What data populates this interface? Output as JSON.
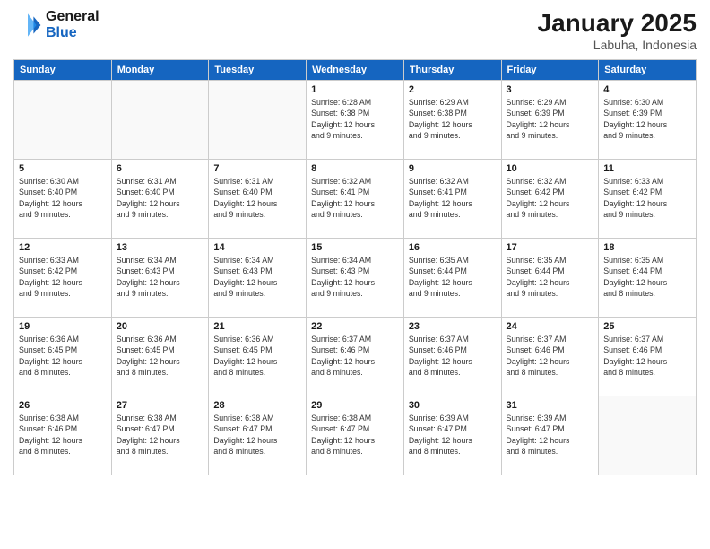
{
  "logo": {
    "line1": "General",
    "line2": "Blue"
  },
  "title": "January 2025",
  "location": "Labuha, Indonesia",
  "days_of_week": [
    "Sunday",
    "Monday",
    "Tuesday",
    "Wednesday",
    "Thursday",
    "Friday",
    "Saturday"
  ],
  "weeks": [
    [
      {
        "day": "",
        "info": ""
      },
      {
        "day": "",
        "info": ""
      },
      {
        "day": "",
        "info": ""
      },
      {
        "day": "1",
        "info": "Sunrise: 6:28 AM\nSunset: 6:38 PM\nDaylight: 12 hours\nand 9 minutes."
      },
      {
        "day": "2",
        "info": "Sunrise: 6:29 AM\nSunset: 6:38 PM\nDaylight: 12 hours\nand 9 minutes."
      },
      {
        "day": "3",
        "info": "Sunrise: 6:29 AM\nSunset: 6:39 PM\nDaylight: 12 hours\nand 9 minutes."
      },
      {
        "day": "4",
        "info": "Sunrise: 6:30 AM\nSunset: 6:39 PM\nDaylight: 12 hours\nand 9 minutes."
      }
    ],
    [
      {
        "day": "5",
        "info": "Sunrise: 6:30 AM\nSunset: 6:40 PM\nDaylight: 12 hours\nand 9 minutes."
      },
      {
        "day": "6",
        "info": "Sunrise: 6:31 AM\nSunset: 6:40 PM\nDaylight: 12 hours\nand 9 minutes."
      },
      {
        "day": "7",
        "info": "Sunrise: 6:31 AM\nSunset: 6:40 PM\nDaylight: 12 hours\nand 9 minutes."
      },
      {
        "day": "8",
        "info": "Sunrise: 6:32 AM\nSunset: 6:41 PM\nDaylight: 12 hours\nand 9 minutes."
      },
      {
        "day": "9",
        "info": "Sunrise: 6:32 AM\nSunset: 6:41 PM\nDaylight: 12 hours\nand 9 minutes."
      },
      {
        "day": "10",
        "info": "Sunrise: 6:32 AM\nSunset: 6:42 PM\nDaylight: 12 hours\nand 9 minutes."
      },
      {
        "day": "11",
        "info": "Sunrise: 6:33 AM\nSunset: 6:42 PM\nDaylight: 12 hours\nand 9 minutes."
      }
    ],
    [
      {
        "day": "12",
        "info": "Sunrise: 6:33 AM\nSunset: 6:42 PM\nDaylight: 12 hours\nand 9 minutes."
      },
      {
        "day": "13",
        "info": "Sunrise: 6:34 AM\nSunset: 6:43 PM\nDaylight: 12 hours\nand 9 minutes."
      },
      {
        "day": "14",
        "info": "Sunrise: 6:34 AM\nSunset: 6:43 PM\nDaylight: 12 hours\nand 9 minutes."
      },
      {
        "day": "15",
        "info": "Sunrise: 6:34 AM\nSunset: 6:43 PM\nDaylight: 12 hours\nand 9 minutes."
      },
      {
        "day": "16",
        "info": "Sunrise: 6:35 AM\nSunset: 6:44 PM\nDaylight: 12 hours\nand 9 minutes."
      },
      {
        "day": "17",
        "info": "Sunrise: 6:35 AM\nSunset: 6:44 PM\nDaylight: 12 hours\nand 9 minutes."
      },
      {
        "day": "18",
        "info": "Sunrise: 6:35 AM\nSunset: 6:44 PM\nDaylight: 12 hours\nand 8 minutes."
      }
    ],
    [
      {
        "day": "19",
        "info": "Sunrise: 6:36 AM\nSunset: 6:45 PM\nDaylight: 12 hours\nand 8 minutes."
      },
      {
        "day": "20",
        "info": "Sunrise: 6:36 AM\nSunset: 6:45 PM\nDaylight: 12 hours\nand 8 minutes."
      },
      {
        "day": "21",
        "info": "Sunrise: 6:36 AM\nSunset: 6:45 PM\nDaylight: 12 hours\nand 8 minutes."
      },
      {
        "day": "22",
        "info": "Sunrise: 6:37 AM\nSunset: 6:46 PM\nDaylight: 12 hours\nand 8 minutes."
      },
      {
        "day": "23",
        "info": "Sunrise: 6:37 AM\nSunset: 6:46 PM\nDaylight: 12 hours\nand 8 minutes."
      },
      {
        "day": "24",
        "info": "Sunrise: 6:37 AM\nSunset: 6:46 PM\nDaylight: 12 hours\nand 8 minutes."
      },
      {
        "day": "25",
        "info": "Sunrise: 6:37 AM\nSunset: 6:46 PM\nDaylight: 12 hours\nand 8 minutes."
      }
    ],
    [
      {
        "day": "26",
        "info": "Sunrise: 6:38 AM\nSunset: 6:46 PM\nDaylight: 12 hours\nand 8 minutes."
      },
      {
        "day": "27",
        "info": "Sunrise: 6:38 AM\nSunset: 6:47 PM\nDaylight: 12 hours\nand 8 minutes."
      },
      {
        "day": "28",
        "info": "Sunrise: 6:38 AM\nSunset: 6:47 PM\nDaylight: 12 hours\nand 8 minutes."
      },
      {
        "day": "29",
        "info": "Sunrise: 6:38 AM\nSunset: 6:47 PM\nDaylight: 12 hours\nand 8 minutes."
      },
      {
        "day": "30",
        "info": "Sunrise: 6:39 AM\nSunset: 6:47 PM\nDaylight: 12 hours\nand 8 minutes."
      },
      {
        "day": "31",
        "info": "Sunrise: 6:39 AM\nSunset: 6:47 PM\nDaylight: 12 hours\nand 8 minutes."
      },
      {
        "day": "",
        "info": ""
      }
    ]
  ]
}
